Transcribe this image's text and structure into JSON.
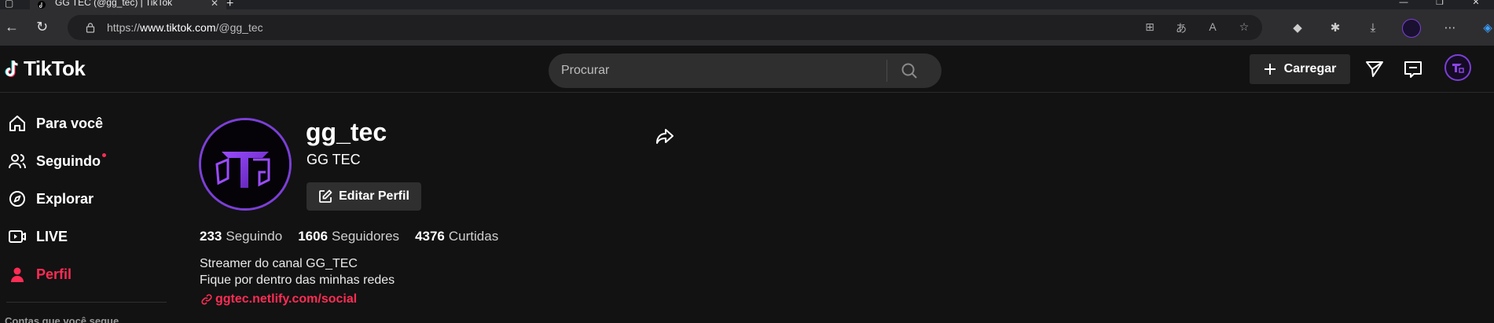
{
  "browser": {
    "tab_title": "GG TEC (@gg_tec) | TikTok",
    "url_prefix": "https://",
    "url_host": "www.tiktok.com",
    "url_path": "/@gg_tec"
  },
  "header": {
    "logo_text": "TikTok",
    "search_placeholder": "Procurar",
    "upload_label": "Carregar"
  },
  "sidebar": {
    "items": [
      {
        "label": "Para você",
        "icon": "home-icon"
      },
      {
        "label": "Seguindo",
        "icon": "following-icon"
      },
      {
        "label": "Explorar",
        "icon": "explore-icon"
      },
      {
        "label": "LIVE",
        "icon": "live-icon"
      },
      {
        "label": "Perfil",
        "icon": "profile-icon"
      }
    ],
    "footer_heading": "Contas que você segue"
  },
  "profile": {
    "username": "gg_tec",
    "nickname": "GG TEC",
    "edit_label": "Editar Perfil",
    "stats": {
      "following_count": "233",
      "following_label": "Seguindo",
      "followers_count": "1606",
      "followers_label": "Seguidores",
      "likes_count": "4376",
      "likes_label": "Curtidas"
    },
    "bio_line1": "Streamer do canal GG_TEC",
    "bio_line2": "Fique por dentro das minhas redes",
    "link": "ggtec.netlify.com/social"
  },
  "colors": {
    "accent": "#fe2c55",
    "brand_purple": "#7b3fd6",
    "background": "#121212"
  }
}
